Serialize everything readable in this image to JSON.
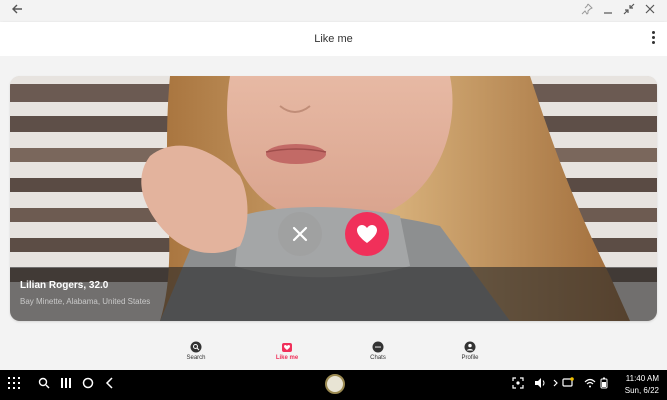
{
  "window": {
    "back_icon": "arrow-left-icon",
    "pin_icon": "pin-icon",
    "minimize_icon": "minimize-icon",
    "fullscreen_icon": "fullscreen-exit-icon",
    "close_icon": "close-icon"
  },
  "header": {
    "title": "Like me",
    "menu_icon": "more-vertical-icon"
  },
  "profile_card": {
    "name_age": "Lilian Rogers, 32.0",
    "location": "Bay Minette, Alabama, United States",
    "dislike_icon": "close-icon",
    "like_icon": "heart-icon",
    "like_color": "#f0305a"
  },
  "nav": {
    "items": [
      {
        "label": "Search",
        "icon": "search-icon",
        "active": false
      },
      {
        "label": "Like me",
        "icon": "like-me-icon",
        "active": true
      },
      {
        "label": "Chats",
        "icon": "chat-icon",
        "active": false
      },
      {
        "label": "Profile",
        "icon": "profile-icon",
        "active": false
      }
    ],
    "accent_color": "#f0305a"
  },
  "taskbar": {
    "time": "11:40 AM",
    "date": "Sun, 6/22"
  }
}
